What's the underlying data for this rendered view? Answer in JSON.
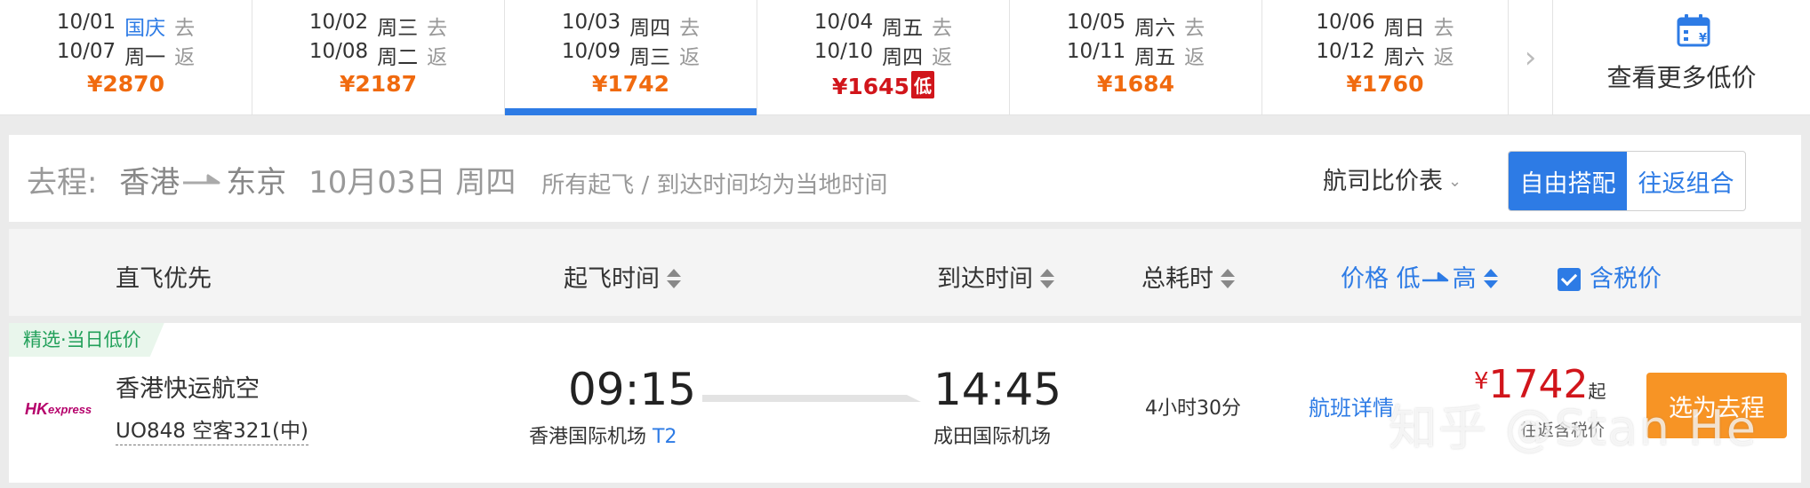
{
  "date_strip": {
    "cells": [
      {
        "go_date": "10/01",
        "go_week": "国庆",
        "go_tag": "去",
        "ret_date": "10/07",
        "ret_week": "周一",
        "ret_tag": "返",
        "price": "¥2870"
      },
      {
        "go_date": "10/02",
        "go_week": "周三",
        "go_tag": "去",
        "ret_date": "10/08",
        "ret_week": "周二",
        "ret_tag": "返",
        "price": "¥2187"
      },
      {
        "go_date": "10/03",
        "go_week": "周四",
        "go_tag": "去",
        "ret_date": "10/09",
        "ret_week": "周三",
        "ret_tag": "返",
        "price": "¥1742"
      },
      {
        "go_date": "10/04",
        "go_week": "周五",
        "go_tag": "去",
        "ret_date": "10/10",
        "ret_week": "周四",
        "ret_tag": "返",
        "price": "¥1645",
        "badge": "低"
      },
      {
        "go_date": "10/05",
        "go_week": "周六",
        "go_tag": "去",
        "ret_date": "10/11",
        "ret_week": "周五",
        "ret_tag": "返",
        "price": "¥1684"
      },
      {
        "go_date": "10/06",
        "go_week": "周日",
        "go_tag": "去",
        "ret_date": "10/12",
        "ret_week": "周六",
        "ret_tag": "返",
        "price": "¥1760"
      }
    ],
    "selected_index": 2,
    "lowest_index": 3,
    "holiday_index": 0,
    "next_icon": "›",
    "more_low_price_label": "查看更多低价",
    "calendar_icon": "calendar-yen-icon"
  },
  "route_bar": {
    "label": "去程:",
    "from": "香港",
    "to": "东京",
    "date": "10月03日 周四",
    "note": "所有起飞 / 到达时间均为当地时间",
    "compare_label": "航司比价表",
    "toggle": {
      "free_combo": "自由搭配",
      "round_trip": "往返组合",
      "active": "free_combo"
    }
  },
  "sort_bar": {
    "direct_first": "直飞优先",
    "depart_time": "起飞时间",
    "arrive_time": "到达时间",
    "total_duration": "总耗时",
    "price_label": "价格 低",
    "price_high": "高",
    "tax_included": "含税价",
    "tax_checked": true
  },
  "flight": {
    "ribbon": "精选·当日低价",
    "airline_logo": "HKexpress",
    "airline_name": "香港快运航空",
    "flight_info": "UO848 空客321(中)",
    "dep_time": "09:15",
    "dep_airport": "香港国际机场",
    "dep_terminal": "T2",
    "arr_time": "14:45",
    "arr_airport": "成田国际机场",
    "duration": "4小时30分",
    "details_link": "航班详情",
    "price_currency": "¥",
    "price_value": "1742",
    "price_suffix": "起",
    "price_note": "往返含税价",
    "select_button": "选为去程"
  },
  "watermark": "知乎 @Stan He",
  "colors": {
    "brand_blue": "#2d7be5",
    "price_orange": "#f06a0f",
    "price_red": "#d1151b",
    "button_orange": "#f79425",
    "ribbon_green": "#22a05a"
  }
}
